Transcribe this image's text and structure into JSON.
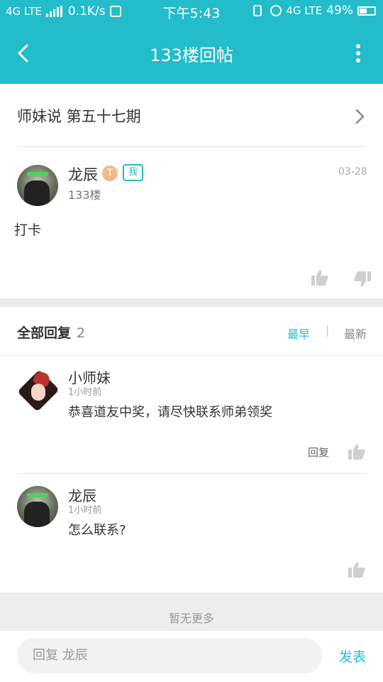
{
  "status_bar": {
    "network_left": "4G LTE",
    "speed": "0.1K/s",
    "time": "下午5:43",
    "network_right": "4G LTE",
    "battery": "49%"
  },
  "nav": {
    "title": "133楼回帖"
  },
  "thread": {
    "title": "师妹说 第五十七期"
  },
  "post": {
    "author": "龙辰",
    "level_badge": "T",
    "me_badge": "我",
    "floor": "133楼",
    "date": "03-28",
    "body": "打卡"
  },
  "replies_header": {
    "label": "全部回复",
    "count": "2",
    "sort_earliest": "最早",
    "sort_sep": "|",
    "sort_latest": "最新"
  },
  "replies": [
    {
      "author": "小师妹",
      "time": "1小时前",
      "text": "恭喜道友中奖，请尽快联系师弟领奖",
      "reply_label": "回复"
    },
    {
      "author": "龙辰",
      "time": "1小时前",
      "text": "怎么联系?"
    }
  ],
  "footer": {
    "no_more": "暂无更多",
    "input_placeholder": "回复 龙辰",
    "publish": "发表"
  },
  "colors": {
    "accent": "#23bccb"
  }
}
